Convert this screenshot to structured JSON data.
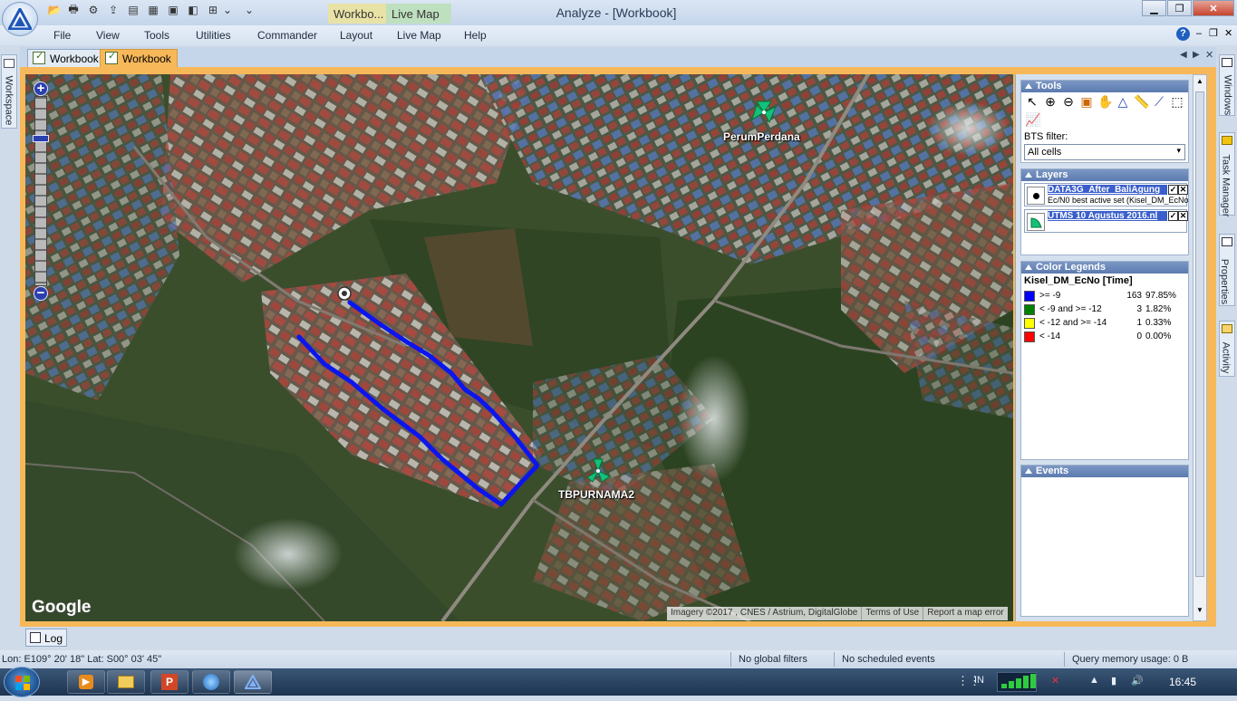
{
  "window": {
    "title": "Analyze - [Workbook]",
    "context_tabs": [
      "Workbo...",
      "Live Map"
    ]
  },
  "menu": [
    "File",
    "View",
    "Tools",
    "Utilities",
    "Commander",
    "Layout",
    "Live Map",
    "Help"
  ],
  "doc_tabs": [
    {
      "label": "Workbook",
      "active": false
    },
    {
      "label": "Workbook",
      "active": true
    }
  ],
  "left_dock": [
    "Workspace"
  ],
  "right_dock": [
    "Windows",
    "Task Manager",
    "Properties",
    "Activity"
  ],
  "map": {
    "sites": [
      {
        "name": "PerumPerdana"
      },
      {
        "name": "TBPURNAMA2"
      }
    ],
    "google_logo": "Google",
    "attribution": [
      "Imagery ©2017 , CNES / Astrium, DigitalGlobe",
      "Terms of Use",
      "Report a map error"
    ],
    "route_color": "#0b16ee"
  },
  "panel": {
    "tools": {
      "title": "Tools",
      "bts_filter_label": "BTS filter:",
      "bts_filter_value": "All cells"
    },
    "layers": {
      "title": "Layers",
      "items": [
        {
          "name": "DATA3G_After_BaliAgung",
          "sub": "Ec/N0 best active set (Kisel_DM_EcNo"
        },
        {
          "name": "UTMS 10 Agustus 2016.nl",
          "sub": ""
        }
      ]
    },
    "legends": {
      "title": "Color Legends",
      "heading": "Kisel_DM_EcNo [Time]",
      "rows": [
        {
          "label": ">= -9",
          "count": "163",
          "pct": "97.85%",
          "color": "#0000ff"
        },
        {
          "label": "< -9 and >= -12",
          "count": "3",
          "pct": "1.82%",
          "color": "#008000"
        },
        {
          "label": "< -12 and >= -14",
          "count": "1",
          "pct": "0.33%",
          "color": "#ffff00"
        },
        {
          "label": "< -14",
          "count": "0",
          "pct": "0.00%",
          "color": "#ff0000"
        }
      ]
    },
    "events": {
      "title": "Events"
    }
  },
  "log_tab": "Log",
  "status": {
    "coords": "Lon: E109° 20' 18\" Lat: S00° 03' 45\"",
    "filters": "No global filters",
    "events": "No scheduled events",
    "memory": "Query memory usage: 0 B"
  },
  "taskbar": {
    "lang": "IN",
    "time": "16:45"
  }
}
